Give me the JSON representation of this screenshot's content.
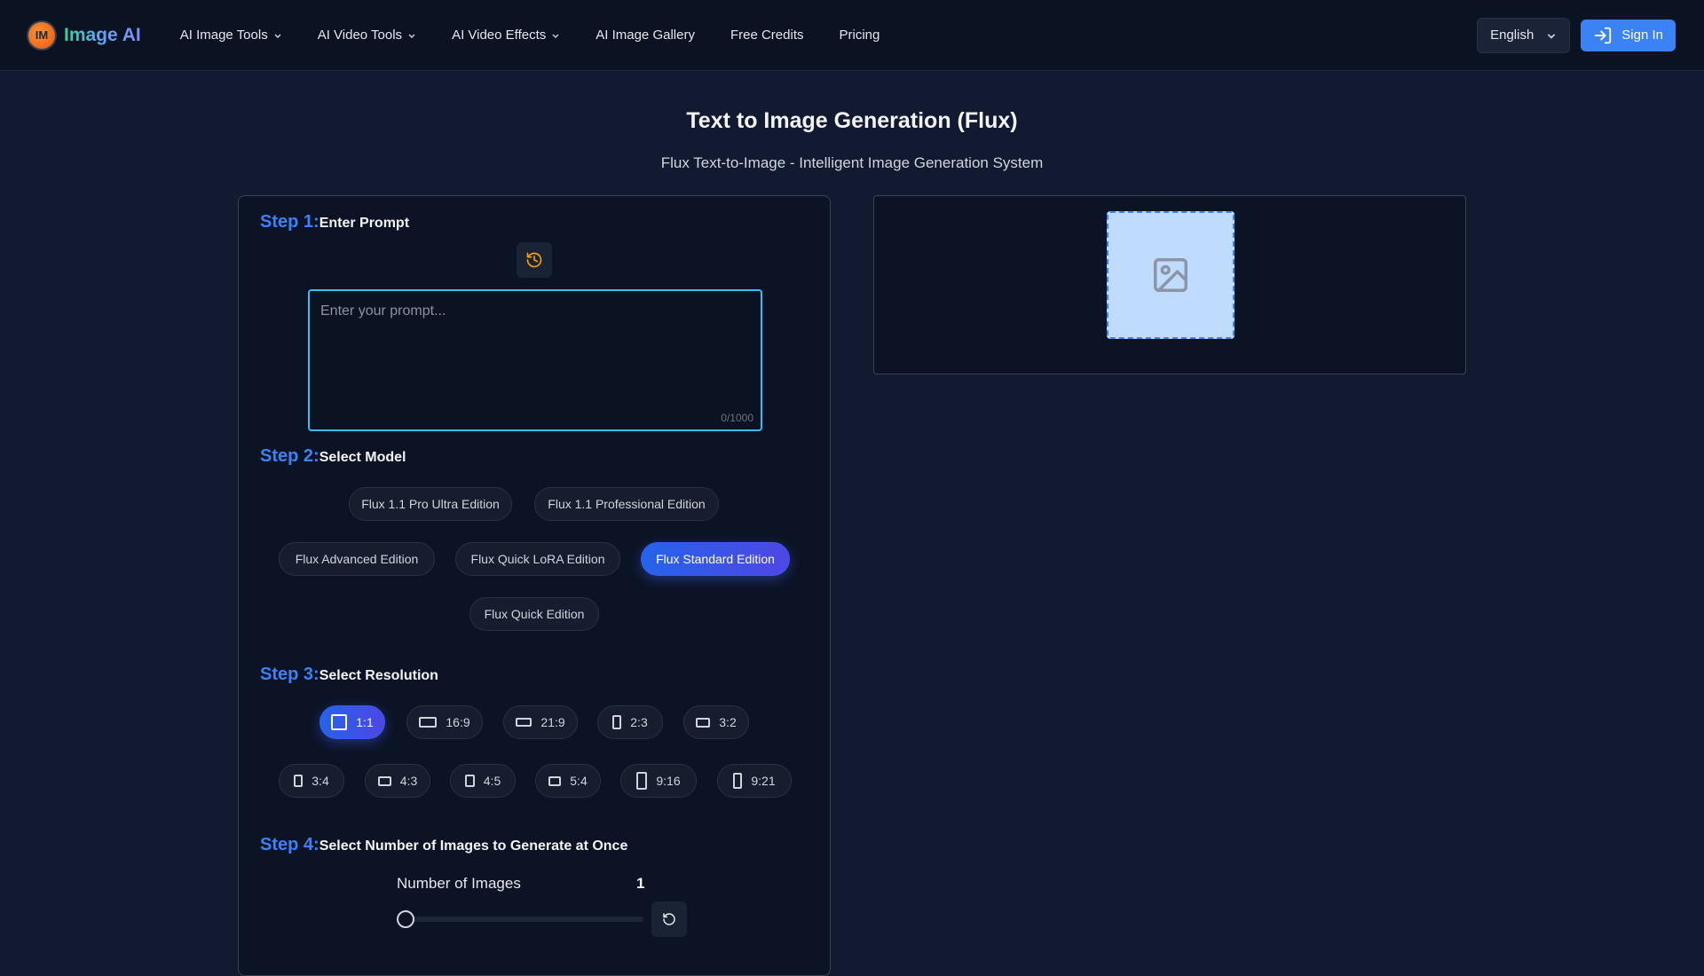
{
  "header": {
    "logo_text": "IM",
    "brand_name": "Image AI",
    "nav": [
      {
        "label": "AI Image Tools",
        "dropdown": true
      },
      {
        "label": "AI Video Tools",
        "dropdown": true
      },
      {
        "label": "AI Video Effects",
        "dropdown": true
      },
      {
        "label": "AI Image Gallery",
        "dropdown": false
      },
      {
        "label": "Free Credits",
        "dropdown": false
      },
      {
        "label": "Pricing",
        "dropdown": false
      }
    ],
    "language": "English",
    "sign_in": "Sign In"
  },
  "page": {
    "title": "Text to Image Generation (Flux)",
    "subtitle": "Flux Text-to-Image - Intelligent Image Generation System"
  },
  "steps": {
    "s1": {
      "num": "Step 1:",
      "label": "Enter Prompt"
    },
    "s2": {
      "num": "Step 2:",
      "label": "Select Model"
    },
    "s3": {
      "num": "Step 3:",
      "label": "Select Resolution"
    },
    "s4": {
      "num": "Step 4:",
      "label": "Select Number of Images to Generate at Once"
    }
  },
  "prompt": {
    "value": "",
    "placeholder": "Enter your prompt...",
    "char_count": "0/1000"
  },
  "models": {
    "items": [
      "Flux 1.1 Pro Ultra Edition",
      "Flux 1.1 Professional Edition",
      "Flux Advanced Edition",
      "Flux Quick LoRA Edition",
      "Flux Standard Edition",
      "Flux Quick Edition"
    ],
    "selected": "Flux Standard Edition"
  },
  "resolutions": {
    "items": [
      "1:1",
      "16:9",
      "21:9",
      "2:3",
      "3:2",
      "3:4",
      "4:3",
      "4:5",
      "5:4",
      "9:16",
      "9:21"
    ],
    "selected": "1:1"
  },
  "image_count": {
    "label": "Number of Images",
    "value": "1",
    "min": 1,
    "max": 4
  },
  "colors": {
    "accent": "#3b82f6",
    "background": "#111a30",
    "panel": "#0c1324"
  }
}
